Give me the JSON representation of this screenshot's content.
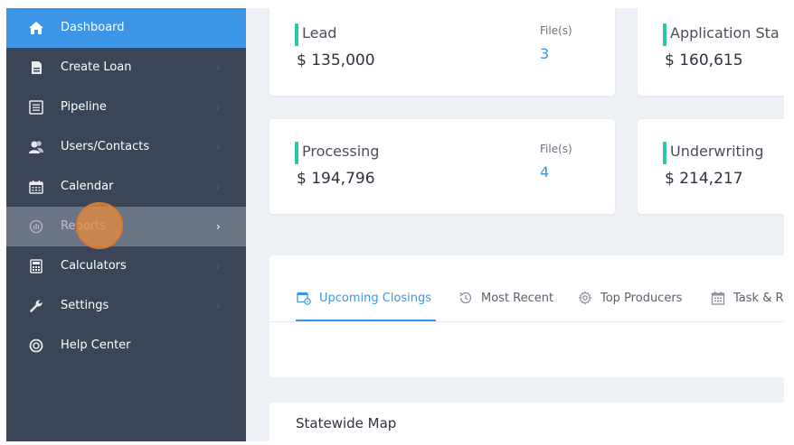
{
  "sidebar": {
    "items": [
      {
        "label": "Dashboard",
        "icon": "home-icon"
      },
      {
        "label": "Create Loan",
        "icon": "document-icon"
      },
      {
        "label": "Pipeline",
        "icon": "list-icon"
      },
      {
        "label": "Users/Contacts",
        "icon": "users-icon"
      },
      {
        "label": "Calendar",
        "icon": "calendar-icon"
      },
      {
        "label": "Reports",
        "icon": "reports-icon"
      },
      {
        "label": "Calculators",
        "icon": "calculator-icon"
      },
      {
        "label": "Settings",
        "icon": "wrench-icon"
      },
      {
        "label": "Help Center",
        "icon": "lifebuoy-icon"
      }
    ],
    "chevron": "›"
  },
  "cards": [
    {
      "title": "Lead",
      "amount": "$ 135,000",
      "files_label": "File(s)",
      "files_value": "3"
    },
    {
      "title": "Application Sta",
      "amount": "$ 160,615"
    },
    {
      "title": "Processing",
      "amount": "$ 194,796",
      "files_label": "File(s)",
      "files_value": "4"
    },
    {
      "title": "Underwriting",
      "amount": "$ 214,217"
    }
  ],
  "tabs": [
    {
      "label": "Upcoming Closings",
      "icon": "calendar-clock-icon",
      "active": true
    },
    {
      "label": "Most Recent",
      "icon": "history-icon"
    },
    {
      "label": "Top Producers",
      "icon": "gear-icon"
    },
    {
      "label": "Task & R",
      "icon": "calendar-grid-icon"
    }
  ],
  "map": {
    "title": "Statewide Map"
  },
  "colors": {
    "sidebar_bg": "#3a4557",
    "accent": "#3d95e8",
    "status_bar": "#2ec4a7",
    "page_bg": "#eef1f6"
  }
}
